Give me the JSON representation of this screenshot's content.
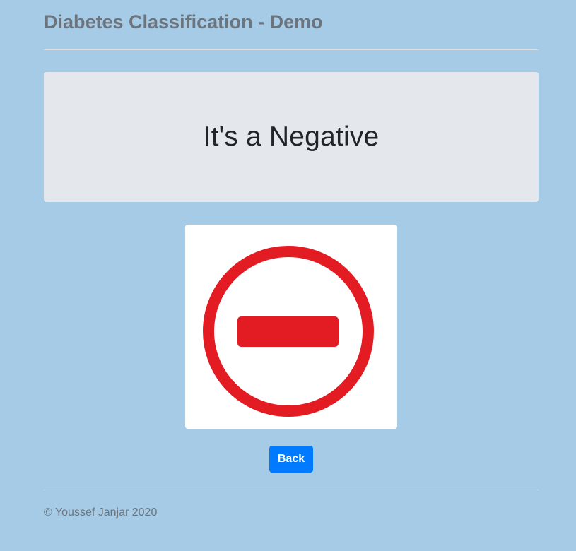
{
  "header": {
    "title": "Diabetes Classification - Demo"
  },
  "result": {
    "heading": "It's a Negative",
    "image_icon": "no-entry-icon",
    "icon_color": "#e31b23"
  },
  "actions": {
    "back_label": "Back"
  },
  "footer": {
    "copyright": "© Youssef Janjar 2020"
  },
  "colors": {
    "background": "#a6cbe6",
    "button": "#007bff",
    "panel": "#e4e8ed"
  }
}
